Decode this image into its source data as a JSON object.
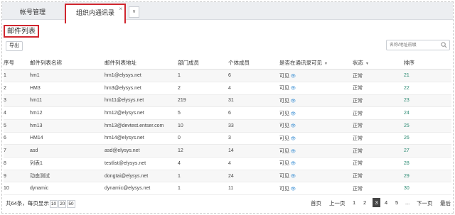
{
  "tabs": [
    {
      "label": "帐号管理"
    },
    {
      "label": "组织内通讯录",
      "close": "×"
    }
  ],
  "tab_more": "∨",
  "list_title": "邮件列表",
  "export_label": "导出",
  "search": {
    "placeholder": "名称/地址前缀"
  },
  "columns": [
    "序号",
    "邮件列表名称",
    "邮件列表地址",
    "部门成员",
    "个体成员",
    "是否在通讯录可见",
    "状态",
    "排序"
  ],
  "rows": [
    {
      "no": "1",
      "name": "hm1",
      "addr": "hm1@elysys.net",
      "dept": "1",
      "ind": "6",
      "vis": "可见",
      "status": "正常",
      "sort": "21"
    },
    {
      "no": "2",
      "name": "HM3",
      "addr": "hm3@elysys.net",
      "dept": "2",
      "ind": "4",
      "vis": "可见",
      "status": "正常",
      "sort": "22"
    },
    {
      "no": "3",
      "name": "hm11",
      "addr": "hm11@elysys.net",
      "dept": "219",
      "ind": "31",
      "vis": "可见",
      "status": "正常",
      "sort": "23"
    },
    {
      "no": "4",
      "name": "hm12",
      "addr": "hm12@elysys.net",
      "dept": "5",
      "ind": "6",
      "vis": "可见",
      "status": "正常",
      "sort": "24"
    },
    {
      "no": "5",
      "name": "hm13",
      "addr": "hm13@devtest.entser.com",
      "dept": "10",
      "ind": "33",
      "vis": "可见",
      "status": "正常",
      "sort": "25"
    },
    {
      "no": "6",
      "name": "HM14",
      "addr": "hm14@elysys.net",
      "dept": "0",
      "ind": "3",
      "vis": "可见",
      "status": "正常",
      "sort": "26"
    },
    {
      "no": "7",
      "name": "asd",
      "addr": "asd@elysys.net",
      "dept": "12",
      "ind": "14",
      "vis": "可见",
      "status": "正常",
      "sort": "27"
    },
    {
      "no": "8",
      "name": "列表1",
      "addr": "testlist@elysys.net",
      "dept": "4",
      "ind": "4",
      "vis": "可见",
      "status": "正常",
      "sort": "28"
    },
    {
      "no": "9",
      "name": "动态测试",
      "addr": "dongtai@elysys.net",
      "dept": "1",
      "ind": "24",
      "vis": "可见",
      "status": "正常",
      "sort": "29"
    },
    {
      "no": "10",
      "name": "dynamic",
      "addr": "dynamic@elysys.net",
      "dept": "1",
      "ind": "11",
      "vis": "可见",
      "status": "正常",
      "sort": "30"
    }
  ],
  "footer": {
    "summary": "共64条，每页显示",
    "page_sizes": [
      "10",
      "20",
      "50"
    ],
    "first": "首页",
    "prev": "上一页",
    "pages": [
      "1",
      "2",
      "3",
      "4",
      "5",
      "..."
    ],
    "current_page": "3",
    "next": "下一页",
    "last": "最后"
  }
}
